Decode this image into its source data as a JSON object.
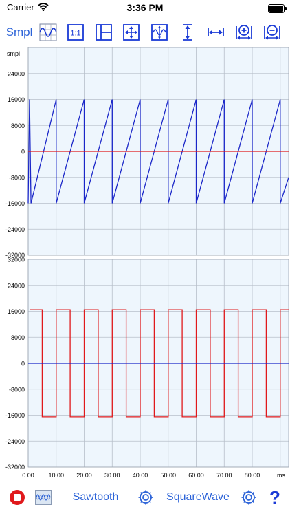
{
  "status_bar": {
    "carrier": "Carrier",
    "time": "3:36 PM"
  },
  "toolbar": {
    "units_label": "Smpl",
    "zoom_reset_label": "1:1",
    "icons": [
      "waveform-grid-icon",
      "one-to-one-icon",
      "split-view-icon",
      "pan-arrows-icon",
      "vertical-fit-icon",
      "vertical-resize-icon",
      "horizontal-resize-icon",
      "zoom-in-horizontal-icon",
      "zoom-out-horizontal-icon"
    ]
  },
  "colors": {
    "accent": "#2c63d8",
    "plot_bg": "#eef6fd",
    "grid": "#b7bfca",
    "channel_1": "#1a26c8",
    "channel_2": "#e0191c",
    "stop": "#e0191c"
  },
  "chart_data": [
    {
      "type": "line",
      "ylabel": "smpl",
      "ylim": [
        -32000,
        32000
      ],
      "y_ticks": [
        "24000",
        "16000",
        "8000",
        "0",
        "-8000",
        "-16000",
        "-24000",
        "-32000"
      ],
      "x_range_ms": [
        0,
        93
      ],
      "grid": true,
      "series": [
        {
          "waveform": "sawtooth",
          "color": "#1a26c8",
          "amplitude": 16000,
          "period_ms": 10,
          "first_peak_ms": 1,
          "points": [
            [
              0,
              -16000
            ],
            [
              0.5,
              16000
            ],
            [
              1,
              -16000
            ],
            [
              10,
              16000
            ],
            [
              10,
              -16000
            ],
            [
              20,
              16000
            ],
            [
              20,
              -16000
            ],
            [
              30,
              16000
            ],
            [
              30,
              -16000
            ],
            [
              40,
              16000
            ],
            [
              40,
              -16000
            ],
            [
              50,
              16000
            ],
            [
              50,
              -16000
            ],
            [
              60,
              16000
            ],
            [
              60,
              -16000
            ],
            [
              70,
              16000
            ],
            [
              70,
              -16000
            ],
            [
              80,
              16000
            ],
            [
              80,
              -16000
            ],
            [
              90,
              16000
            ],
            [
              90,
              -16000
            ],
            [
              93,
              -8000
            ]
          ]
        },
        {
          "waveform": "zero-line",
          "color": "#e0191c",
          "points": [
            [
              0,
              0
            ],
            [
              93,
              0
            ]
          ]
        }
      ]
    },
    {
      "type": "line",
      "ylim": [
        -32000,
        32000
      ],
      "y_ticks": [
        "32000",
        "24000",
        "16000",
        "8000",
        "0",
        "-8000",
        "-16000",
        "-24000",
        "-32000"
      ],
      "x_ticks": [
        "0.00",
        "10.00",
        "20.00",
        "30.00",
        "40.00",
        "50.00",
        "60.00",
        "70.00",
        "80.00"
      ],
      "x_unit": "ms",
      "x_range_ms": [
        0,
        93
      ],
      "grid": true,
      "series": [
        {
          "waveform": "square",
          "color": "#e0191c",
          "points": [
            [
              0.5,
              16500
            ],
            [
              5,
              16500
            ],
            [
              5,
              -16500
            ],
            [
              10,
              -16500
            ],
            [
              10,
              16500
            ],
            [
              15,
              16500
            ],
            [
              15,
              -16500
            ],
            [
              20,
              -16500
            ],
            [
              20,
              16500
            ],
            [
              25,
              16500
            ],
            [
              25,
              -16500
            ],
            [
              30,
              -16500
            ],
            [
              30,
              16500
            ],
            [
              35,
              16500
            ],
            [
              35,
              -16500
            ],
            [
              40,
              -16500
            ],
            [
              40,
              16500
            ],
            [
              45,
              16500
            ],
            [
              45,
              -16500
            ],
            [
              50,
              -16500
            ],
            [
              50,
              16500
            ],
            [
              55,
              16500
            ],
            [
              55,
              -16500
            ],
            [
              60,
              -16500
            ],
            [
              60,
              16500
            ],
            [
              65,
              16500
            ],
            [
              65,
              -16500
            ],
            [
              70,
              -16500
            ],
            [
              70,
              16500
            ],
            [
              75,
              16500
            ],
            [
              75,
              -16500
            ],
            [
              80,
              -16500
            ],
            [
              80,
              16500
            ],
            [
              85,
              16500
            ],
            [
              85,
              -16500
            ],
            [
              90,
              -16500
            ],
            [
              90,
              16500
            ],
            [
              93,
              16500
            ]
          ]
        },
        {
          "waveform": "zero-line",
          "color": "#1a26c8",
          "points": [
            [
              0,
              0
            ],
            [
              93,
              0
            ]
          ]
        }
      ]
    }
  ],
  "bottom_bar": {
    "channel_1_label": "Sawtooth",
    "channel_2_label": "SquareWave",
    "help_label": "?"
  }
}
